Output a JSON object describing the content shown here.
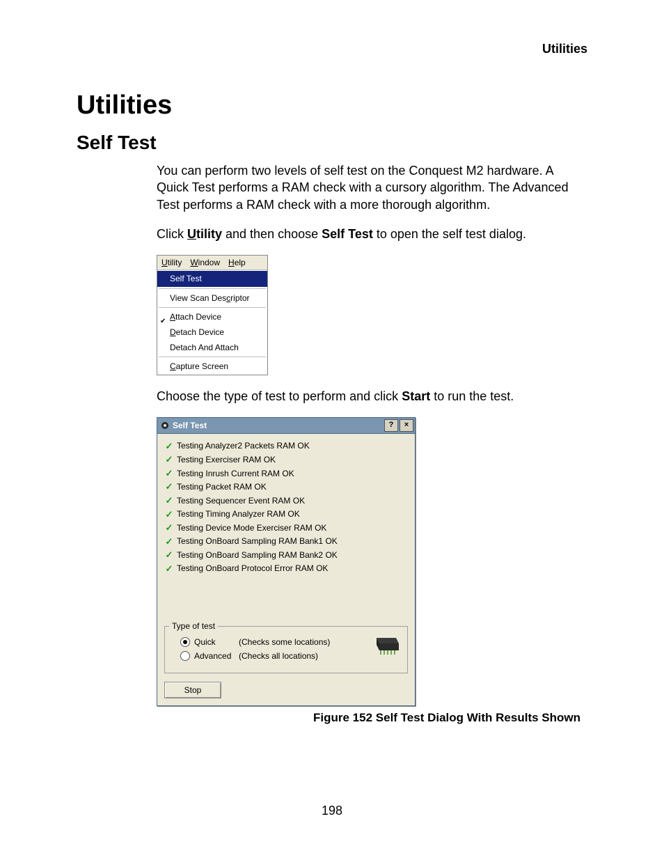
{
  "header": {
    "right": "Utilities"
  },
  "title": "Utilities",
  "section": "Self Test",
  "para1": "You can perform two levels of self test on the Conquest M2 hardware. A Quick Test performs a RAM check with a cursory algorithm. The Advanced Test performs a RAM check with a more thorough algorithm.",
  "para2_pre": "Click ",
  "para2_utility": "Utility",
  "para2_mid": " and then choose ",
  "para2_selftest": "Self Test",
  "para2_post": " to open the self test dialog.",
  "menu": {
    "bar": [
      {
        "label": "Utility",
        "accel": "U"
      },
      {
        "label": "Window",
        "accel": "W"
      },
      {
        "label": "Help",
        "accel": "H"
      }
    ],
    "items": {
      "selftest": {
        "label": "Self Test",
        "accel": "",
        "checked": false,
        "highlight": true
      },
      "viewscan": {
        "label": "View Scan Descriptor",
        "accel": "c",
        "checked": false,
        "highlight": false
      },
      "attach": {
        "label": "Attach Device",
        "accel": "A",
        "checked": true,
        "highlight": false
      },
      "detach": {
        "label": "Detach Device",
        "accel": "D",
        "checked": false,
        "highlight": false
      },
      "detatt": {
        "label": "Detach And Attach",
        "accel": "",
        "checked": false,
        "highlight": false
      },
      "capture": {
        "label": "Capture Screen",
        "accel": "C",
        "checked": false,
        "highlight": false
      }
    }
  },
  "para3_pre": "Choose the type of test to perform and click ",
  "para3_start": "Start",
  "para3_post": " to run the test.",
  "dialog": {
    "title": "Self Test",
    "results": [
      "Testing Analyzer2 Packets RAM OK",
      "Testing Exerciser RAM OK",
      "Testing Inrush Current RAM OK",
      "Testing Packet RAM OK",
      "Testing Sequencer Event RAM OK",
      "Testing Timing Analyzer RAM OK",
      "Testing Device Mode Exerciser RAM OK",
      "Testing OnBoard Sampling RAM Bank1 OK",
      "Testing OnBoard Sampling RAM Bank2 OK",
      "Testing OnBoard Protocol Error RAM OK"
    ],
    "typeof_legend": "Type of test",
    "radios": {
      "quick": {
        "label": "Quick",
        "note": "(Checks some locations)",
        "selected": true
      },
      "advanced": {
        "label": "Advanced",
        "note": "(Checks all locations)",
        "selected": false
      }
    },
    "button": "Stop"
  },
  "figure_caption": "Figure  152  Self Test Dialog With Results Shown",
  "page_number": "198"
}
